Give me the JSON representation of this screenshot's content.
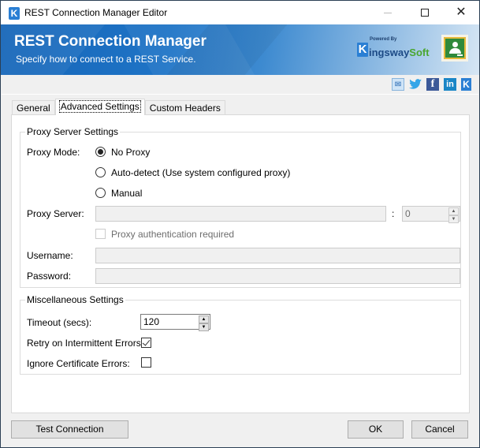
{
  "window": {
    "title": "REST Connection Manager Editor",
    "app_icon_glyph": "K",
    "controls": {
      "minimize": "minimize-icon",
      "maximize": "maximize-icon",
      "close": "✕"
    }
  },
  "banner": {
    "title": "REST Connection Manager",
    "subtitle": "Specify how to connect to a REST Service.",
    "logo": {
      "k": "K",
      "powered_by": "Powered By",
      "name_main": "ingsway",
      "name_accent": "Soft"
    },
    "colors": {
      "banner_start": "#1565b8",
      "banner_end": "#d6e6f4",
      "logo_accent": "#4aa62f"
    }
  },
  "social": [
    {
      "name": "email-icon",
      "glyph": "✉"
    },
    {
      "name": "twitter-icon",
      "glyph": "🐦"
    },
    {
      "name": "facebook-icon",
      "glyph": "f"
    },
    {
      "name": "linkedin-icon",
      "glyph": "in"
    },
    {
      "name": "kingswaysoft-icon",
      "glyph": "K"
    }
  ],
  "tabs": [
    {
      "label": "General",
      "active": false
    },
    {
      "label": "Advanced Settings",
      "active": true
    },
    {
      "label": "Custom Headers",
      "active": false
    }
  ],
  "proxy": {
    "group_title": "Proxy Server Settings",
    "mode_label": "Proxy Mode:",
    "modes": [
      {
        "label": "No Proxy",
        "checked": true
      },
      {
        "label": "Auto-detect (Use system configured proxy)",
        "checked": false
      },
      {
        "label": "Manual",
        "checked": false
      }
    ],
    "server_label": "Proxy Server:",
    "server_value": "",
    "port_separator": ":",
    "port_value": "0",
    "auth_label": "Proxy authentication required",
    "auth_checked": false,
    "username_label": "Username:",
    "username_value": "",
    "password_label": "Password:",
    "password_value": ""
  },
  "misc": {
    "group_title": "Miscellaneous Settings",
    "timeout_label": "Timeout (secs):",
    "timeout_value": "120",
    "retry_label": "Retry on Intermittent Errors:",
    "retry_checked": true,
    "ignore_cert_label": "Ignore Certificate Errors:",
    "ignore_cert_checked": false
  },
  "buttons": {
    "test_connection": "Test Connection",
    "ok": "OK",
    "cancel": "Cancel"
  }
}
